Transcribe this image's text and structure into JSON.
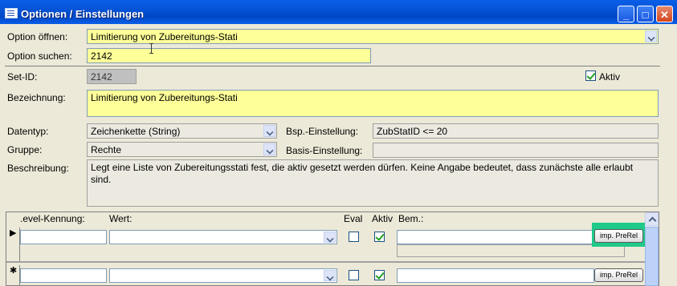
{
  "window": {
    "title": "Optionen / Einstellungen",
    "min": "_",
    "max": "□",
    "close": "✕"
  },
  "top": {
    "option_open_label": "Option öffnen:",
    "option_open_value": "Limitierung von Zubereitungs-Stati",
    "option_search_label": "Option suchen:",
    "option_search_value": "2142"
  },
  "detail": {
    "setid_label": "Set-ID:",
    "setid_value": "2142",
    "aktiv_label": "Aktiv",
    "aktiv_checked": true,
    "bezeichnung_label": "Bezeichnung:",
    "bezeichnung_value": "Limitierung von Zubereitungs-Stati",
    "datentyp_label": "Datentyp:",
    "datentyp_value": "Zeichenkette (String)",
    "bsp_label": "Bsp.-Einstellung:",
    "bsp_value": "ZubStatID <= 20",
    "gruppe_label": "Gruppe:",
    "gruppe_value": "Rechte",
    "basis_label": "Basis-Einstellung:",
    "basis_value": "",
    "beschreibung_label": "Beschreibung:",
    "beschreibung_value": "Legt eine Liste von Zubereitungsstati fest, die aktiv gesetzt werden dürfen. Keine Angabe bedeutet, dass zunächste alle erlaubt sind."
  },
  "subform": {
    "headers": {
      "level": ".evel-Kennung:",
      "wert": "Wert:",
      "eval": "Eval",
      "aktiv": "Aktiv",
      "bem": "Bem.:"
    },
    "rows": [
      {
        "selector": "▶",
        "level": "",
        "wert": "",
        "eval": false,
        "aktiv": true,
        "bem": "",
        "button": "imp. PreRel"
      },
      {
        "selector": "✱",
        "level": "",
        "wert": "",
        "eval": false,
        "aktiv": true,
        "bem": "",
        "button": "imp. PreRel"
      }
    ]
  },
  "colors": {
    "titlebar": "#0553d6",
    "field_yellow": "#ffff99",
    "highlight": "#1ec98a"
  }
}
